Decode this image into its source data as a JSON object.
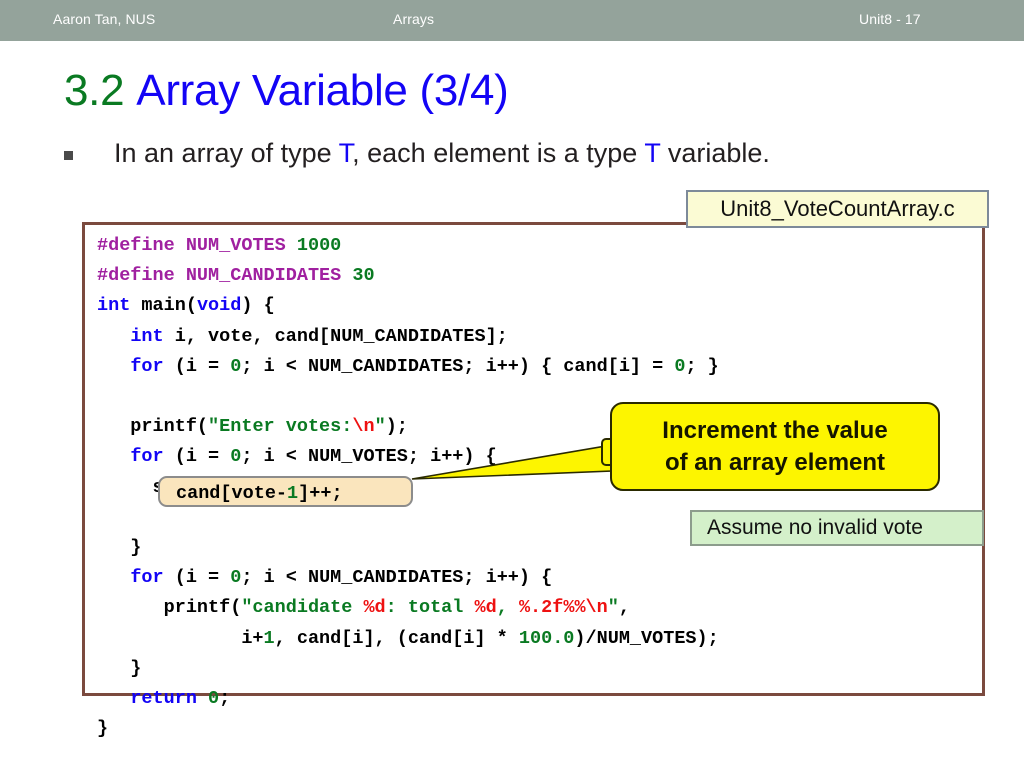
{
  "header": {
    "author": "Aaron Tan, NUS",
    "topic": "Arrays",
    "unit": "Unit8 - 17",
    "bar_color": "#94a39b"
  },
  "title": {
    "number": "3.2",
    "text": "Array Variable (3/4)",
    "color": "#1304f5"
  },
  "bullet": {
    "marker": "square-bullet",
    "part1": "In an array of type ",
    "type1": "T",
    "part2": ", each element is a type ",
    "type2": "T",
    "part3": " variable.",
    "type_color": "#1304f5"
  },
  "filename_label": {
    "text": "Unit8_VoteCountArray.c",
    "fill": "#fbfbd4",
    "border": "#7d8a99"
  },
  "code": {
    "border_color": "#7b4a3e",
    "lines": [
      "#define NUM_VOTES 1000",
      "#define NUM_CANDIDATES 30",
      "int main(void) {",
      "   int i, vote, cand[NUM_CANDIDATES];",
      "   for (i = 0; i < NUM_CANDIDATES; i++) { cand[i] = 0; }",
      "",
      "   printf(\"Enter votes:\\n\");",
      "   for (i = 0; i < NUM_VOTES; i++) {",
      "     scanf(\"%d\", &vote);",
      "     cand[vote-1]++;",
      "   }",
      "   for (i = 0; i < NUM_CANDIDATES; i++) {",
      "      printf(\"candidate %d: total %d, %.2f%%\\n\",",
      "             i+1, cand[i], (cand[i] * 100.0)/NUM_VOTES);",
      "   }",
      "   return 0;",
      "}"
    ],
    "highlighted_line": "cand[vote-1]++;",
    "highlight_fill": "#fae5bd",
    "highlight_border": "#8c8c8c",
    "colors": {
      "keyword": "#1304f5",
      "preprocessor": "#a020a0",
      "number": "#0a7a22",
      "string": "#0a7a22",
      "format_specifier": "#ee1111",
      "plain": "#000000"
    }
  },
  "callout_yellow": {
    "line1": "Increment the value",
    "line2": "of an array element",
    "fill": "#fdf500",
    "border": "#2a2a00"
  },
  "note_green": {
    "text": "Assume no invalid vote",
    "fill": "#d4f0ca",
    "border": "#8c9c8c"
  }
}
